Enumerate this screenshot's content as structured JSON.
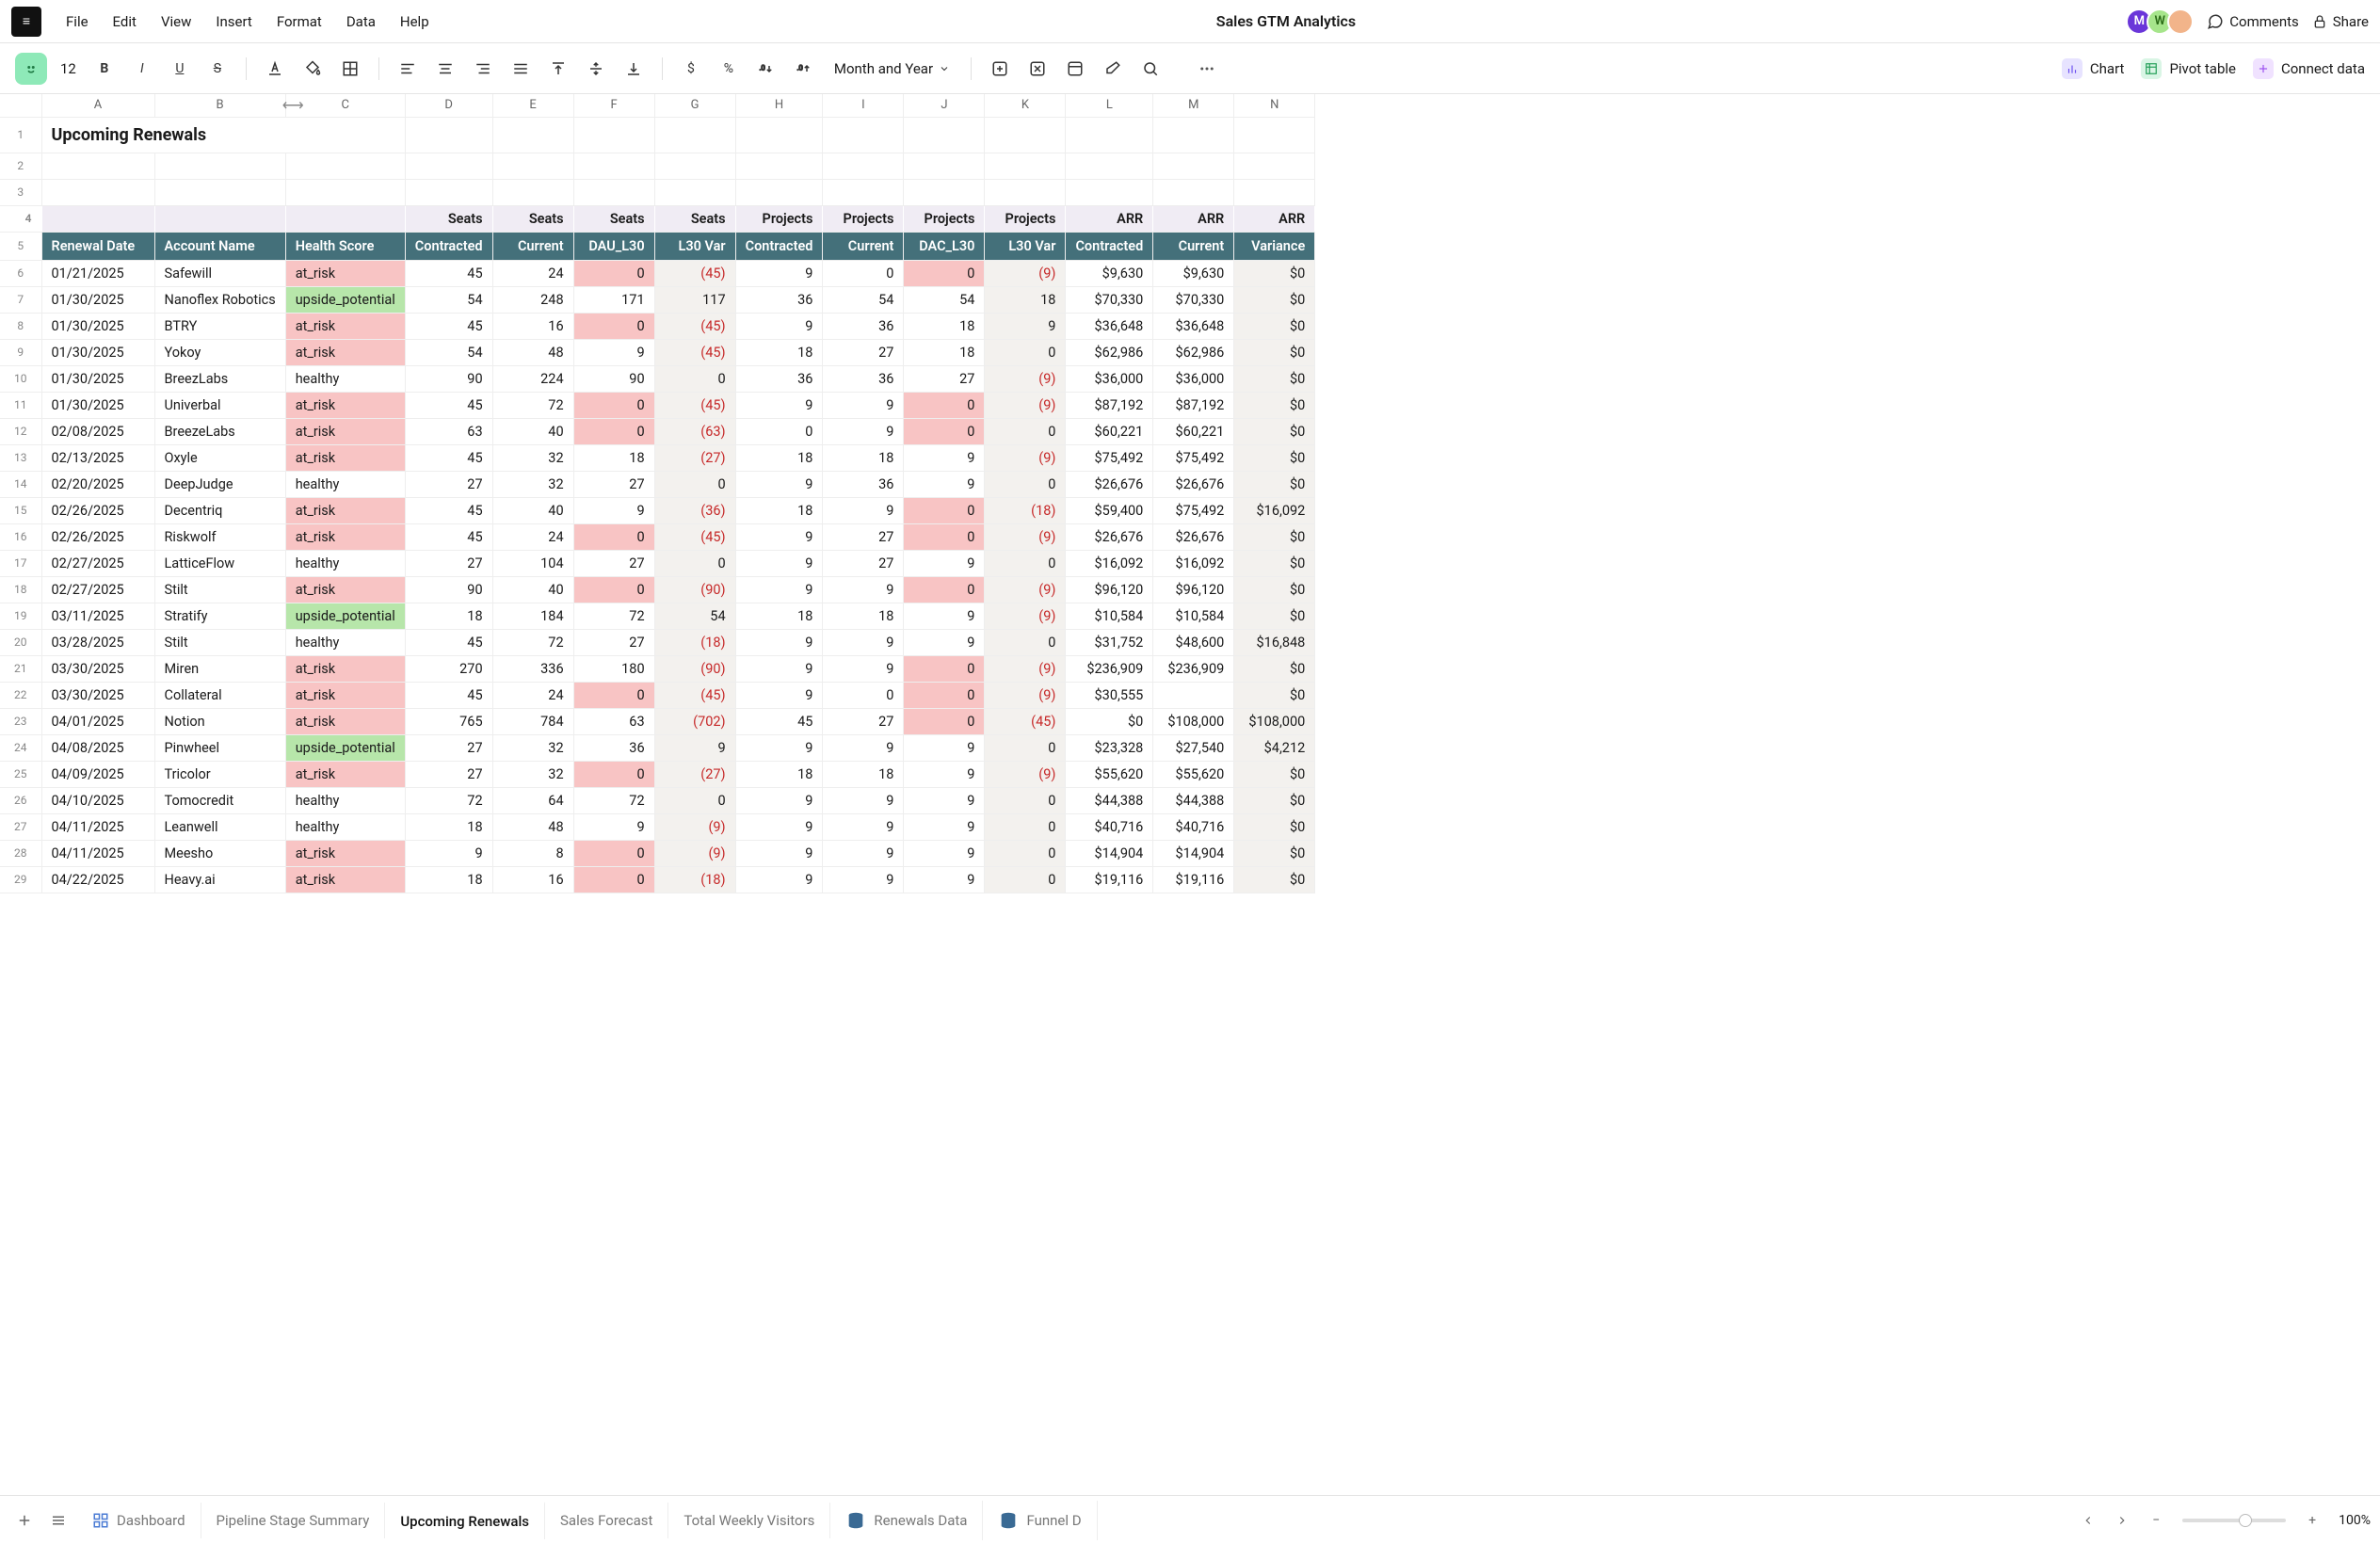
{
  "doc_title": "Sales GTM Analytics",
  "menu": [
    "File",
    "Edit",
    "View",
    "Insert",
    "Format",
    "Data",
    "Help"
  ],
  "menubar_right": {
    "comments": "Comments",
    "share": "Share"
  },
  "avatars": [
    "M",
    "W",
    ""
  ],
  "toolbar": {
    "font_size": "12",
    "date_format": "Month and Year"
  },
  "chips": {
    "chart": "Chart",
    "pivot": "Pivot table",
    "connect": "Connect data"
  },
  "columns": [
    "A",
    "B",
    "C",
    "D",
    "E",
    "F",
    "G",
    "H",
    "I",
    "J",
    "K",
    "L",
    "M",
    "N"
  ],
  "title_row": "Upcoming Renewals",
  "cat_row": [
    "",
    "",
    "",
    "Seats",
    "Seats",
    "Seats",
    "Seats",
    "Projects",
    "Projects",
    "Projects",
    "Projects",
    "ARR",
    "ARR",
    "ARR"
  ],
  "headers": [
    "Renewal Date",
    "Account Name",
    "Health Score",
    "Contracted",
    "Current",
    "DAU_L30",
    "L30 Var",
    "Contracted",
    "Current",
    "DAC_L30",
    "L30 Var",
    "Contracted",
    "Current",
    "Variance"
  ],
  "rows": [
    {
      "d": "01/21/2025",
      "a": "Safewill",
      "h": "at_risk",
      "sc": 45,
      "scur": 24,
      "dau": 0,
      "dauh": true,
      "svar": "(45)",
      "pc": 9,
      "pcur": 0,
      "dac": 0,
      "dach": true,
      "pvar": "(9)",
      "ac": "$9,630",
      "acur": "$9,630",
      "av": "$0"
    },
    {
      "d": "01/30/2025",
      "a": "Nanoflex Robotics",
      "h": "upside_potential",
      "sc": 54,
      "scur": 248,
      "dau": 171,
      "svar": "117",
      "pc": 36,
      "pcur": 54,
      "dac": 54,
      "pvar": "18",
      "ac": "$70,330",
      "acur": "$70,330",
      "av": "$0"
    },
    {
      "d": "01/30/2025",
      "a": "BTRY",
      "h": "at_risk",
      "sc": 45,
      "scur": 16,
      "dau": 0,
      "dauh": true,
      "svar": "(45)",
      "pc": 9,
      "pcur": 36,
      "dac": 18,
      "pvar": "9",
      "ac": "$36,648",
      "acur": "$36,648",
      "av": "$0"
    },
    {
      "d": "01/30/2025",
      "a": "Yokoy",
      "h": "at_risk",
      "sc": 54,
      "scur": 48,
      "dau": 9,
      "svar": "(45)",
      "pc": 18,
      "pcur": 27,
      "dac": 18,
      "pvar": "0",
      "ac": "$62,986",
      "acur": "$62,986",
      "av": "$0"
    },
    {
      "d": "01/30/2025",
      "a": "BreezLabs",
      "h": "healthy",
      "sc": 90,
      "scur": 224,
      "dau": 90,
      "svar": "0",
      "pc": 36,
      "pcur": 36,
      "dac": 27,
      "pvar": "(9)",
      "ac": "$36,000",
      "acur": "$36,000",
      "av": "$0"
    },
    {
      "d": "01/30/2025",
      "a": "Univerbal",
      "h": "at_risk",
      "sc": 45,
      "scur": 72,
      "dau": 0,
      "dauh": true,
      "svar": "(45)",
      "pc": 9,
      "pcur": 9,
      "dac": 0,
      "dach": true,
      "pvar": "(9)",
      "ac": "$87,192",
      "acur": "$87,192",
      "av": "$0"
    },
    {
      "d": "02/08/2025",
      "a": "BreezeLabs",
      "h": "at_risk",
      "sc": 63,
      "scur": 40,
      "dau": 0,
      "dauh": true,
      "svar": "(63)",
      "pc": 0,
      "pcur": 9,
      "dac": 0,
      "dach": true,
      "pvar": "0",
      "ac": "$60,221",
      "acur": "$60,221",
      "av": "$0"
    },
    {
      "d": "02/13/2025",
      "a": "Oxyle",
      "h": "at_risk",
      "sc": 45,
      "scur": 32,
      "dau": 18,
      "svar": "(27)",
      "pc": 18,
      "pcur": 18,
      "dac": 9,
      "pvar": "(9)",
      "ac": "$75,492",
      "acur": "$75,492",
      "av": "$0"
    },
    {
      "d": "02/20/2025",
      "a": "DeepJudge",
      "h": "healthy",
      "sc": 27,
      "scur": 32,
      "dau": 27,
      "svar": "0",
      "pc": 9,
      "pcur": 36,
      "dac": 9,
      "pvar": "0",
      "ac": "$26,676",
      "acur": "$26,676",
      "av": "$0"
    },
    {
      "d": "02/26/2025",
      "a": "Decentriq",
      "h": "at_risk",
      "sc": 45,
      "scur": 40,
      "dau": 9,
      "svar": "(36)",
      "pc": 18,
      "pcur": 9,
      "dac": 0,
      "dach": true,
      "pvar": "(18)",
      "ac": "$59,400",
      "acur": "$75,492",
      "av": "$16,092"
    },
    {
      "d": "02/26/2025",
      "a": "Riskwolf",
      "h": "at_risk",
      "sc": 45,
      "scur": 24,
      "dau": 0,
      "dauh": true,
      "svar": "(45)",
      "pc": 9,
      "pcur": 27,
      "dac": 0,
      "dach": true,
      "pvar": "(9)",
      "ac": "$26,676",
      "acur": "$26,676",
      "av": "$0"
    },
    {
      "d": "02/27/2025",
      "a": "LatticeFlow",
      "h": "healthy",
      "sc": 27,
      "scur": 104,
      "dau": 27,
      "svar": "0",
      "pc": 9,
      "pcur": 27,
      "dac": 9,
      "pvar": "0",
      "ac": "$16,092",
      "acur": "$16,092",
      "av": "$0"
    },
    {
      "d": "02/27/2025",
      "a": "Stilt",
      "h": "at_risk",
      "sc": 90,
      "scur": 40,
      "dau": 0,
      "dauh": true,
      "svar": "(90)",
      "pc": 9,
      "pcur": 9,
      "dac": 0,
      "dach": true,
      "pvar": "(9)",
      "ac": "$96,120",
      "acur": "$96,120",
      "av": "$0"
    },
    {
      "d": "03/11/2025",
      "a": "Stratify",
      "h": "upside_potential",
      "sc": 18,
      "scur": 184,
      "dau": 72,
      "svar": "54",
      "pc": 18,
      "pcur": 18,
      "dac": 9,
      "pvar": "(9)",
      "ac": "$10,584",
      "acur": "$10,584",
      "av": "$0"
    },
    {
      "d": "03/28/2025",
      "a": "Stilt",
      "h": "healthy",
      "sc": 45,
      "scur": 72,
      "dau": 27,
      "svar": "(18)",
      "pc": 9,
      "pcur": 9,
      "dac": 9,
      "pvar": "0",
      "ac": "$31,752",
      "acur": "$48,600",
      "av": "$16,848"
    },
    {
      "d": "03/30/2025",
      "a": "Miren",
      "h": "at_risk",
      "sc": 270,
      "scur": 336,
      "dau": 180,
      "svar": "(90)",
      "pc": 9,
      "pcur": 9,
      "dac": 0,
      "dach": true,
      "pvar": "(9)",
      "ac": "$236,909",
      "acur": "$236,909",
      "av": "$0"
    },
    {
      "d": "03/30/2025",
      "a": "Collateral",
      "h": "at_risk",
      "sc": 45,
      "scur": 24,
      "dau": 0,
      "dauh": true,
      "svar": "(45)",
      "pc": 9,
      "pcur": 0,
      "dac": 0,
      "dach": true,
      "pvar": "(9)",
      "ac": "$30,555",
      "acur": "",
      "av": "$0"
    },
    {
      "d": "04/01/2025",
      "a": "Notion",
      "h": "at_risk",
      "sc": 765,
      "scur": 784,
      "dau": 63,
      "svar": "(702)",
      "pc": 45,
      "pcur": 27,
      "dac": 0,
      "dach": true,
      "pvar": "(45)",
      "ac": "$0",
      "acur": "$108,000",
      "av": "$108,000"
    },
    {
      "d": "04/08/2025",
      "a": "Pinwheel",
      "h": "upside_potential",
      "sc": 27,
      "scur": 32,
      "dau": 36,
      "svar": "9",
      "pc": 9,
      "pcur": 9,
      "dac": 9,
      "pvar": "0",
      "ac": "$23,328",
      "acur": "$27,540",
      "av": "$4,212"
    },
    {
      "d": "04/09/2025",
      "a": "Tricolor",
      "h": "at_risk",
      "sc": 27,
      "scur": 32,
      "dau": 0,
      "dauh": true,
      "svar": "(27)",
      "pc": 18,
      "pcur": 18,
      "dac": 9,
      "pvar": "(9)",
      "ac": "$55,620",
      "acur": "$55,620",
      "av": "$0"
    },
    {
      "d": "04/10/2025",
      "a": "Tomocredit",
      "h": "healthy",
      "sc": 72,
      "scur": 64,
      "dau": 72,
      "svar": "0",
      "pc": 9,
      "pcur": 9,
      "dac": 9,
      "pvar": "0",
      "ac": "$44,388",
      "acur": "$44,388",
      "av": "$0"
    },
    {
      "d": "04/11/2025",
      "a": "Leanwell",
      "h": "healthy",
      "sc": 18,
      "scur": 48,
      "dau": 9,
      "svar": "(9)",
      "pc": 9,
      "pcur": 9,
      "dac": 9,
      "pvar": "0",
      "ac": "$40,716",
      "acur": "$40,716",
      "av": "$0"
    },
    {
      "d": "04/11/2025",
      "a": "Meesho",
      "h": "at_risk",
      "sc": 9,
      "scur": 8,
      "dau": 0,
      "dauh": true,
      "svar": "(9)",
      "pc": 9,
      "pcur": 9,
      "dac": 9,
      "pvar": "0",
      "ac": "$14,904",
      "acur": "$14,904",
      "av": "$0"
    },
    {
      "d": "04/22/2025",
      "a": "Heavy.ai",
      "h": "at_risk",
      "sc": 18,
      "scur": 16,
      "dau": 0,
      "dauh": true,
      "svar": "(18)",
      "pc": 9,
      "pcur": 9,
      "dac": 9,
      "pvar": "0",
      "ac": "$19,116",
      "acur": "$19,116",
      "av": "$0"
    }
  ],
  "tabs": [
    {
      "label": "Dashboard",
      "icon": "grid"
    },
    {
      "label": "Pipeline Stage Summary"
    },
    {
      "label": "Upcoming Renewals",
      "active": true
    },
    {
      "label": "Sales Forecast"
    },
    {
      "label": "Total Weekly Visitors"
    },
    {
      "label": "Renewals Data",
      "icon": "pg"
    },
    {
      "label": "Funnel D",
      "icon": "pg"
    }
  ],
  "zoom": "100%"
}
